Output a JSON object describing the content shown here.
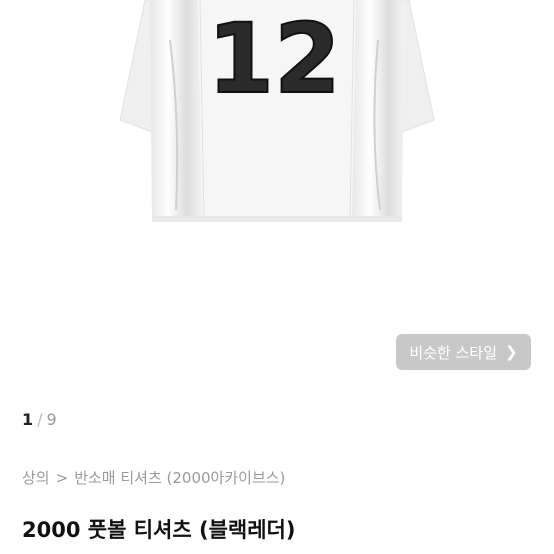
{
  "gallery": {
    "jersey_number": "12",
    "similar_style_button": "비슷한 스타일",
    "similar_style_icon": "chevron-right-icon",
    "page_current": "1",
    "page_separator": "/",
    "page_total": "9"
  },
  "breadcrumb": {
    "level1": "상의",
    "separator": ">",
    "level2": "반소매 티셔츠 (2000아카이브스)"
  },
  "product": {
    "title": "2000 풋볼 티셔츠 (블랙레더)"
  },
  "colors": {
    "number_fill": "#2b2b2b",
    "button_bg": "#c8c8c8",
    "shirt": "#f4f4f4"
  }
}
